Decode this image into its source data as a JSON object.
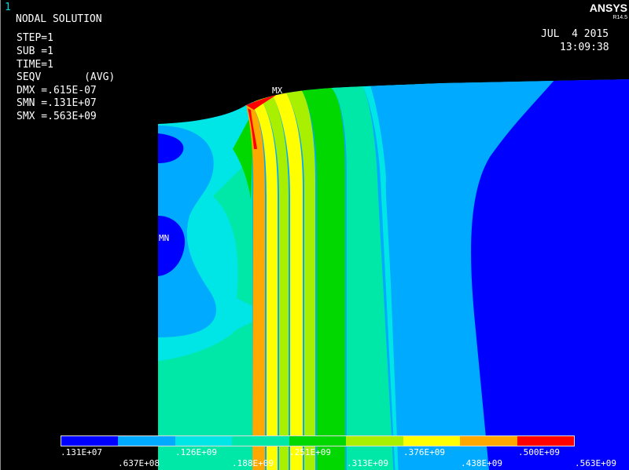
{
  "window_number": "1",
  "brand": "ANSYS",
  "version": "R14.5",
  "header": {
    "title": "NODAL SOLUTION",
    "step": "STEP=1",
    "sub": "SUB =1",
    "time": "TIME=1",
    "result": "SEQV       (AVG)",
    "dmx": "DMX =.615E-07",
    "smn": "SMN =.131E+07",
    "smx": "SMX =.563E+09"
  },
  "date": "JUL  4 2015",
  "clock": "13:09:38",
  "markers": {
    "max": "MX",
    "min": "MN"
  },
  "legend": {
    "colors": [
      "#0000ff",
      "#00aaff",
      "#00e5e5",
      "#00e8a8",
      "#00d800",
      "#a8f000",
      "#ffff00",
      "#ffa800",
      "#ff0000"
    ],
    "labels_top": [
      ".131E+07",
      ".126E+09",
      ".251E+09",
      ".376E+09",
      ".500E+09"
    ],
    "labels_bottom": [
      ".637E+08",
      ".188E+09",
      ".313E+09",
      ".438E+09",
      ".563E+09"
    ]
  }
}
